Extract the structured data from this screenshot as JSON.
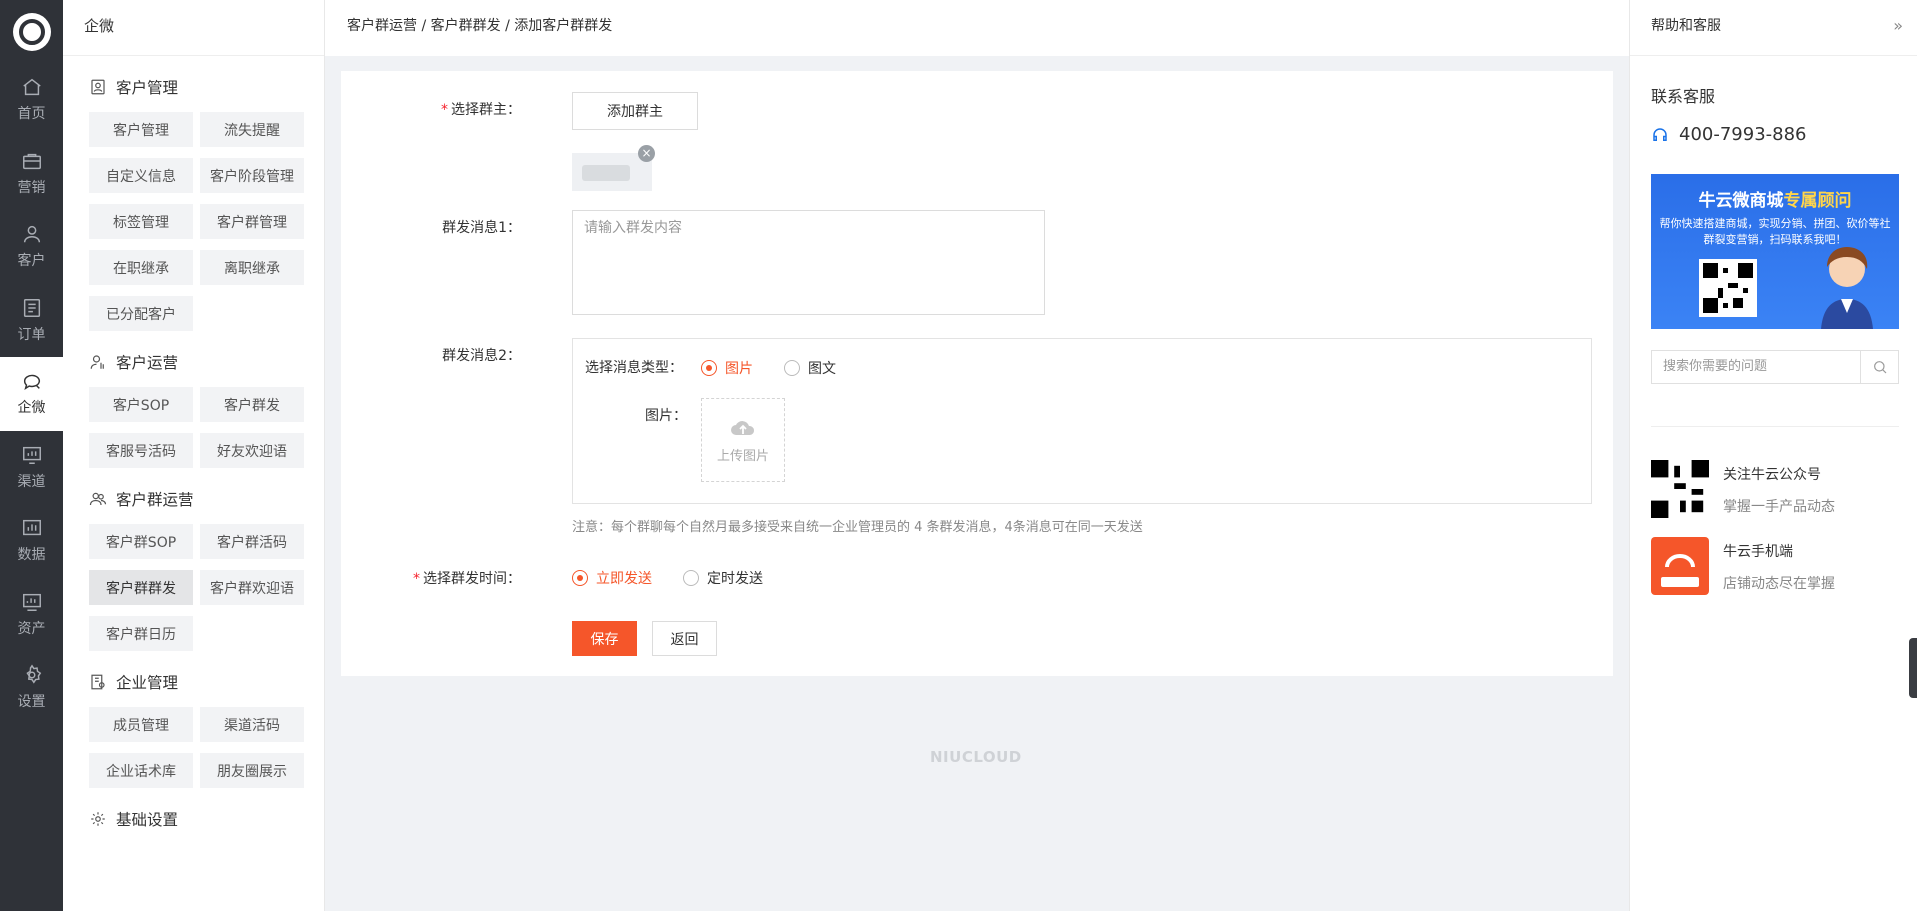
{
  "rail": {
    "items": [
      {
        "label": "首页",
        "icon": "home-icon"
      },
      {
        "label": "营销",
        "icon": "bag-icon"
      },
      {
        "label": "客户",
        "icon": "user-icon"
      },
      {
        "label": "订单",
        "icon": "list-icon"
      },
      {
        "label": "企微",
        "icon": "chat-icon",
        "active": true
      },
      {
        "label": "渠道",
        "icon": "monitor-icon"
      },
      {
        "label": "数据",
        "icon": "chart-icon"
      },
      {
        "label": "资产",
        "icon": "asset-icon"
      },
      {
        "label": "设置",
        "icon": "gear-icon"
      }
    ]
  },
  "submenu": {
    "title": "企微",
    "groups": [
      {
        "title": "客户管理",
        "items": [
          "客户管理",
          "流失提醒",
          "自定义信息",
          "客户阶段管理",
          "标签管理",
          "客户群管理",
          "在职继承",
          "离职继承",
          "已分配客户"
        ]
      },
      {
        "title": "客户运营",
        "items": [
          "客户SOP",
          "客户群发",
          "客服号活码",
          "好友欢迎语"
        ]
      },
      {
        "title": "客户群运营",
        "items": [
          "客户群SOP",
          "客户群活码",
          "客户群群发",
          "客户群欢迎语",
          "客户群日历"
        ],
        "active": "客户群群发"
      },
      {
        "title": "企业管理",
        "items": [
          "成员管理",
          "渠道活码",
          "企业话术库",
          "朋友圈展示"
        ]
      },
      {
        "title": "基础设置",
        "items": []
      }
    ]
  },
  "breadcrumb": "客户群运营 / 客户群群发 / 添加客户群群发",
  "form": {
    "owner_label": "选择群主：",
    "owner_button": "添加群主",
    "msg1_label": "群发消息1：",
    "msg1_placeholder": "请输入群发内容",
    "msg2_label": "群发消息2：",
    "msg_type_label": "选择消息类型：",
    "msg_type_options": [
      "图片",
      "图文"
    ],
    "msg_type_selected": "图片",
    "image_label": "图片：",
    "upload_label": "上传图片",
    "note": "注意：每个群聊每个自然月最多接受来自统一企业管理员的 4 条群发消息，4条消息可在同一天发送",
    "time_label": "选择群发时间：",
    "time_options": [
      "立即发送",
      "定时发送"
    ],
    "time_selected": "立即发送",
    "save": "保存",
    "back": "返回"
  },
  "footer_brand": "NIUCLOUD",
  "right": {
    "title": "帮助和客服",
    "contact_title": "联系客服",
    "phone": "400-7993-886",
    "banner_title_a": "牛云微商城",
    "banner_title_b": "专属顾问",
    "banner_text": "帮你快速搭建商城，实现分销、拼团、砍价等社群裂变营销，扫码联系我吧！",
    "search_placeholder": "搜索你需要的问题",
    "promos": [
      {
        "title": "关注牛云公众号",
        "desc": "掌握一手产品动态"
      },
      {
        "title": "牛云手机端",
        "desc": "店铺动态尽在掌握"
      }
    ]
  },
  "colors": {
    "accent": "#f5562a",
    "rail": "#2f3238",
    "link": "#1a73e8"
  }
}
